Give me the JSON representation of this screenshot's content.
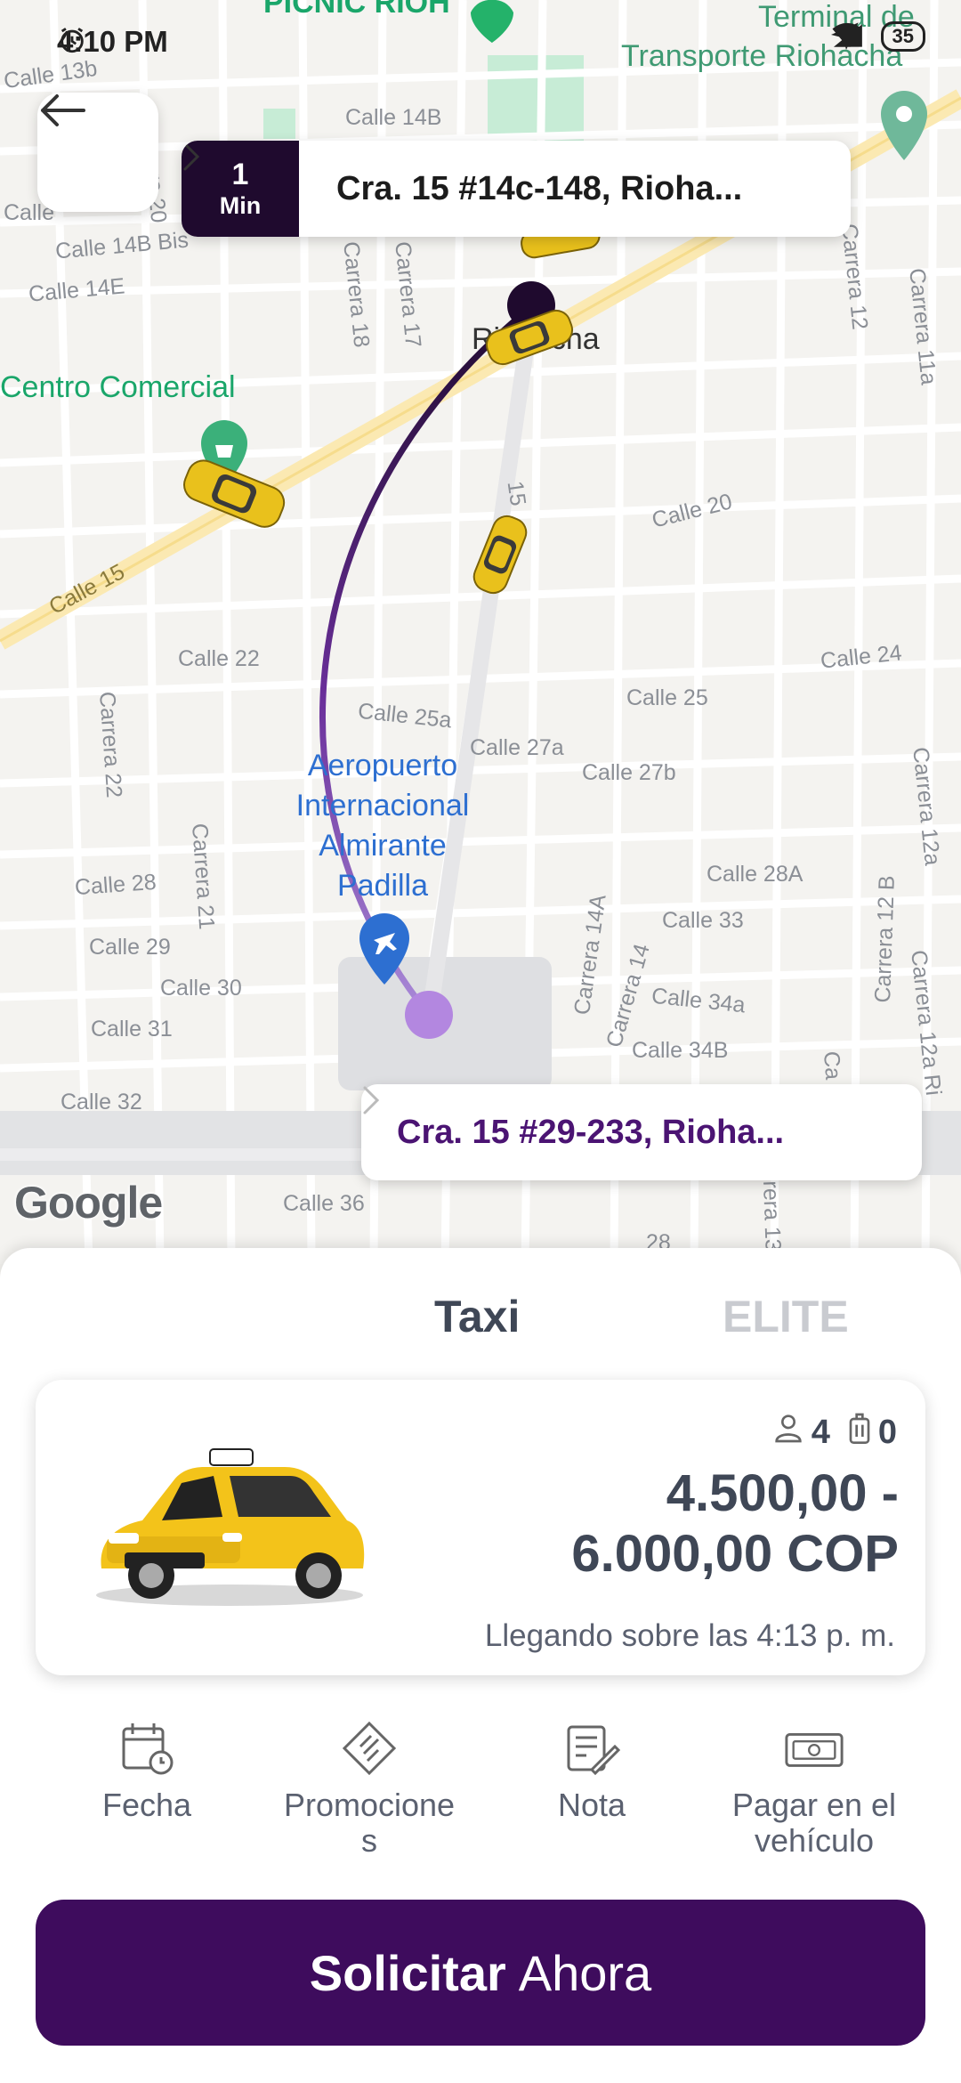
{
  "status_bar": {
    "time": "4:10 PM",
    "battery": "35"
  },
  "trip": {
    "eta_value": "1",
    "eta_unit": "Min",
    "pickup_address": "Cra. 15 #14c-148, Rioha...",
    "dropoff_address": "Cra. 15 #29-233, Rioha..."
  },
  "map": {
    "poi": {
      "picnic": "PICNIC RIOH",
      "terminal_line1": "Terminal de",
      "terminal_line2": "Transporte Riohacha",
      "centro_comercial": "Centro Comercial",
      "riohacha": "Riohacha",
      "airport_lines": [
        "Aeropuerto",
        "Internacional",
        "Almirante",
        "Padilla"
      ]
    },
    "streets": {
      "calle_13b": "Calle 13b",
      "calle_14b": "Calle 14B",
      "calle_14b_bis": "Calle 14B Bis",
      "calle_14e": "Calle 14E",
      "calle_prefix": "Calle",
      "calle_15": "Calle 15",
      "calle_20": "Calle 20",
      "calle_22": "Calle 22",
      "calle_24": "Calle 24",
      "calle_25": "Calle 25",
      "calle_25a": "Calle 25a",
      "calle_27a": "Calle 27a",
      "calle_27b": "Calle 27b",
      "calle_28": "Calle 28",
      "calle_28a": "Calle 28A",
      "calle_29": "Calle 29",
      "calle_30": "Calle 30",
      "calle_31": "Calle 31",
      "calle_32": "Calle 32",
      "calle_33": "Calle 33",
      "calle_34a": "Calle 34a",
      "calle_34b": "Calle 34B",
      "calle_36": "Calle 36",
      "num_15": "15",
      "num_28": "28",
      "carrera_20": "Carrera 20",
      "carrera_18": "Carrera 18",
      "carrera_17": "Carrera 17",
      "carrera_12": "Carrera 12",
      "carrera_11a": "Carrera 11a",
      "carrera_22": "Carrera 22",
      "carrera_21": "Carrera 21",
      "carrera_14a": "Carrera 14A",
      "carrera_14": "Carrera 14",
      "carrera_12b": "Carrera 12 B",
      "carrera_12a": "Carrera 12a",
      "carrera_12a_ri": "Carrera 12a Ri",
      "ca": "Ca",
      "rera_13": "rera 13"
    },
    "attribution": "Google"
  },
  "sheet": {
    "tabs": [
      {
        "label": "Taxi",
        "selected": true
      },
      {
        "label": "ELITE",
        "selected": false
      }
    ],
    "ride_option": {
      "passengers": "4",
      "luggage": "0",
      "price_line1": "4.500,00 -",
      "price_line2": "6.000,00 COP",
      "arrival": "Llegando sobre las 4:13 p. m."
    },
    "options": {
      "date": "Fecha",
      "promotions_line1": "Promocione",
      "promotions_line2": "s",
      "note": "Nota",
      "pay_line1": "Pagar en el",
      "pay_line2": "vehículo"
    },
    "cta_bold": "Solicitar",
    "cta_regular": "Ahora"
  },
  "colors": {
    "brand_dark": "#1f0a2e",
    "brand_purple": "#3e0c5d",
    "route_start": "#7b4bb8",
    "route_end": "#2a0a40",
    "text_gray": "#3f4756",
    "taxi_yellow": "#f3c31a"
  }
}
